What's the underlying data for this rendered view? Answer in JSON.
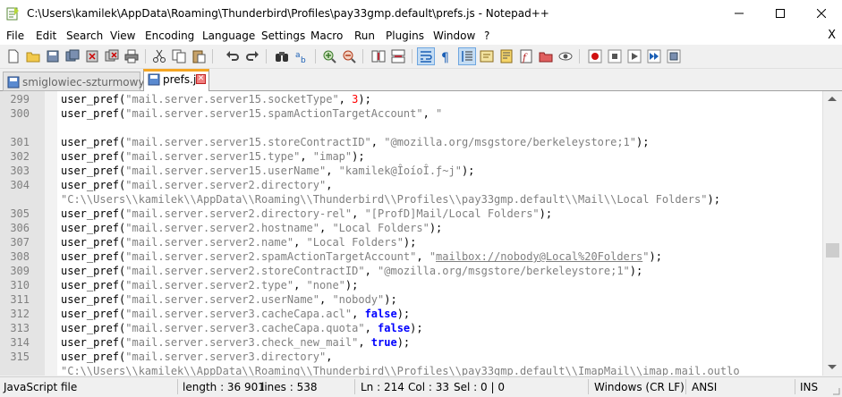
{
  "window": {
    "title": "C:\\Users\\kamilek\\AppData\\Roaming\\Thunderbird\\Profiles\\pay33gmp.default\\prefs.js - Notepad++",
    "minimize": "—",
    "maximize": "☐",
    "close": "✕"
  },
  "menu": {
    "items": [
      "File",
      "Edit",
      "Search",
      "View",
      "Encoding",
      "Language",
      "Settings",
      "Macro",
      "Run",
      "Plugins",
      "Window",
      "?"
    ],
    "close_doc": "X"
  },
  "tabs": [
    {
      "label": "smiglowiec-szturmowy.txt",
      "active": false
    },
    {
      "label": "prefs.js",
      "active": true
    }
  ],
  "colors": {
    "accent_tab": "#f5a623",
    "string": "#808080",
    "number": "#ff0000",
    "keyword": "#0000ff"
  },
  "editor": {
    "lines": [
      {
        "n": "299",
        "tokens": [
          {
            "t": "user_pref(",
            "c": "fn"
          },
          {
            "t": "\"mail.server.server15.socketType\"",
            "c": "str"
          },
          {
            "t": ", ",
            "c": "fn"
          },
          {
            "t": "3",
            "c": "num"
          },
          {
            "t": ");",
            "c": "fn"
          }
        ]
      },
      {
        "n": "300",
        "tokens": [
          {
            "t": "user_pref(",
            "c": "fn"
          },
          {
            "t": "\"mail.server.server15.spamActionTargetAccount\"",
            "c": "str"
          },
          {
            "t": ", ",
            "c": "fn"
          },
          {
            "t": "\"",
            "c": "str"
          }
        ]
      },
      {
        "n": "",
        "tokens": []
      },
      {
        "n": "301",
        "tokens": [
          {
            "t": "user_pref(",
            "c": "fn"
          },
          {
            "t": "\"mail.server.server15.storeContractID\"",
            "c": "str"
          },
          {
            "t": ", ",
            "c": "fn"
          },
          {
            "t": "\"@mozilla.org/msgstore/berkeleystore;1\"",
            "c": "str"
          },
          {
            "t": ");",
            "c": "fn"
          }
        ]
      },
      {
        "n": "302",
        "tokens": [
          {
            "t": "user_pref(",
            "c": "fn"
          },
          {
            "t": "\"mail.server.server15.type\"",
            "c": "str"
          },
          {
            "t": ", ",
            "c": "fn"
          },
          {
            "t": "\"imap\"",
            "c": "str"
          },
          {
            "t": ");",
            "c": "fn"
          }
        ]
      },
      {
        "n": "303",
        "tokens": [
          {
            "t": "user_pref(",
            "c": "fn"
          },
          {
            "t": "\"mail.server.server15.userName\"",
            "c": "str"
          },
          {
            "t": ", ",
            "c": "fn"
          },
          {
            "t": "\"kamilek@ÎoíoÎ.ƒ~j\"",
            "c": "str"
          },
          {
            "t": ");",
            "c": "fn"
          }
        ]
      },
      {
        "n": "304",
        "tokens": [
          {
            "t": "user_pref(",
            "c": "fn"
          },
          {
            "t": "\"mail.server.server2.directory\"",
            "c": "str"
          },
          {
            "t": ",",
            "c": "fn"
          }
        ]
      },
      {
        "n": "",
        "tokens": [
          {
            "t": "\"C:\\\\Users\\\\kamilek\\\\AppData\\\\Roaming\\\\Thunderbird\\\\Profiles\\\\pay33gmp.default\\\\Mail\\\\Local Folders\"",
            "c": "str"
          },
          {
            "t": ");",
            "c": "fn"
          }
        ]
      },
      {
        "n": "305",
        "tokens": [
          {
            "t": "user_pref(",
            "c": "fn"
          },
          {
            "t": "\"mail.server.server2.directory-rel\"",
            "c": "str"
          },
          {
            "t": ", ",
            "c": "fn"
          },
          {
            "t": "\"[ProfD]Mail/Local Folders\"",
            "c": "str"
          },
          {
            "t": ");",
            "c": "fn"
          }
        ]
      },
      {
        "n": "306",
        "tokens": [
          {
            "t": "user_pref(",
            "c": "fn"
          },
          {
            "t": "\"mail.server.server2.hostname\"",
            "c": "str"
          },
          {
            "t": ", ",
            "c": "fn"
          },
          {
            "t": "\"Local Folders\"",
            "c": "str"
          },
          {
            "t": ");",
            "c": "fn"
          }
        ]
      },
      {
        "n": "307",
        "tokens": [
          {
            "t": "user_pref(",
            "c": "fn"
          },
          {
            "t": "\"mail.server.server2.name\"",
            "c": "str"
          },
          {
            "t": ", ",
            "c": "fn"
          },
          {
            "t": "\"Local Folders\"",
            "c": "str"
          },
          {
            "t": ");",
            "c": "fn"
          }
        ]
      },
      {
        "n": "308",
        "tokens": [
          {
            "t": "user_pref(",
            "c": "fn"
          },
          {
            "t": "\"mail.server.server2.spamActionTargetAccount\"",
            "c": "str"
          },
          {
            "t": ", ",
            "c": "fn"
          },
          {
            "t": "\"",
            "c": "str"
          },
          {
            "t": "mailbox://nobody@Local%20Folders",
            "c": "str link"
          },
          {
            "t": "\"",
            "c": "str"
          },
          {
            "t": ");",
            "c": "fn"
          }
        ]
      },
      {
        "n": "309",
        "tokens": [
          {
            "t": "user_pref(",
            "c": "fn"
          },
          {
            "t": "\"mail.server.server2.storeContractID\"",
            "c": "str"
          },
          {
            "t": ", ",
            "c": "fn"
          },
          {
            "t": "\"@mozilla.org/msgstore/berkeleystore;1\"",
            "c": "str"
          },
          {
            "t": ");",
            "c": "fn"
          }
        ]
      },
      {
        "n": "310",
        "tokens": [
          {
            "t": "user_pref(",
            "c": "fn"
          },
          {
            "t": "\"mail.server.server2.type\"",
            "c": "str"
          },
          {
            "t": ", ",
            "c": "fn"
          },
          {
            "t": "\"none\"",
            "c": "str"
          },
          {
            "t": ");",
            "c": "fn"
          }
        ]
      },
      {
        "n": "311",
        "tokens": [
          {
            "t": "user_pref(",
            "c": "fn"
          },
          {
            "t": "\"mail.server.server2.userName\"",
            "c": "str"
          },
          {
            "t": ", ",
            "c": "fn"
          },
          {
            "t": "\"nobody\"",
            "c": "str"
          },
          {
            "t": ");",
            "c": "fn"
          }
        ]
      },
      {
        "n": "312",
        "tokens": [
          {
            "t": "user_pref(",
            "c": "fn"
          },
          {
            "t": "\"mail.server.server3.cacheCapa.acl\"",
            "c": "str"
          },
          {
            "t": ", ",
            "c": "fn"
          },
          {
            "t": "false",
            "c": "kw"
          },
          {
            "t": ");",
            "c": "fn"
          }
        ]
      },
      {
        "n": "313",
        "tokens": [
          {
            "t": "user_pref(",
            "c": "fn"
          },
          {
            "t": "\"mail.server.server3.cacheCapa.quota\"",
            "c": "str"
          },
          {
            "t": ", ",
            "c": "fn"
          },
          {
            "t": "false",
            "c": "kw"
          },
          {
            "t": ");",
            "c": "fn"
          }
        ]
      },
      {
        "n": "314",
        "tokens": [
          {
            "t": "user_pref(",
            "c": "fn"
          },
          {
            "t": "\"mail.server.server3.check_new_mail\"",
            "c": "str"
          },
          {
            "t": ", ",
            "c": "fn"
          },
          {
            "t": "true",
            "c": "kw"
          },
          {
            "t": ");",
            "c": "fn"
          }
        ]
      },
      {
        "n": "315",
        "tokens": [
          {
            "t": "user_pref(",
            "c": "fn"
          },
          {
            "t": "\"mail.server.server3.directory\"",
            "c": "str"
          },
          {
            "t": ",",
            "c": "fn"
          }
        ]
      },
      {
        "n": "",
        "tokens": [
          {
            "t": "\"C:\\\\Users\\\\kamilek\\\\AppData\\\\Roaming\\\\Thunderbird\\\\Profiles\\\\pay33gmp.default\\\\ImapMail\\\\imap.mail.outlo",
            "c": "str"
          }
        ]
      }
    ]
  },
  "status": {
    "filetype": "JavaScript file",
    "length": "length : 36 901",
    "lines": "lines : 538",
    "ln": "Ln : 214",
    "col": "Col : 33",
    "sel": "Sel : 0 | 0",
    "eol": "Windows (CR LF)",
    "encoding": "ANSI",
    "mode": "INS"
  }
}
